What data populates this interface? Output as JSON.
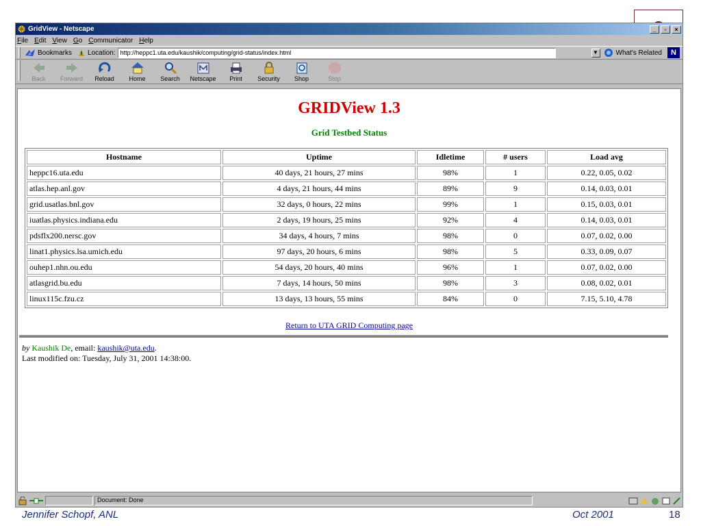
{
  "window": {
    "title": "GridView - Netscape"
  },
  "menu": [
    "File",
    "Edit",
    "View",
    "Go",
    "Communicator",
    "Help"
  ],
  "location_bar": {
    "bookmarks_label": "Bookmarks",
    "location_label": "Location:",
    "url": "http://heppc1.uta.edu/kaushik/computing/grid-status/index.html",
    "related_label": "What's Related"
  },
  "nav": [
    {
      "label": "Back",
      "icon": "back-arrow-icon",
      "disabled": true
    },
    {
      "label": "Forward",
      "icon": "forward-arrow-icon",
      "disabled": true
    },
    {
      "label": "Reload",
      "icon": "reload-icon",
      "disabled": false
    },
    {
      "label": "Home",
      "icon": "home-icon",
      "disabled": false
    },
    {
      "label": "Search",
      "icon": "search-icon",
      "disabled": false
    },
    {
      "label": "Netscape",
      "icon": "netscape-icon",
      "disabled": false
    },
    {
      "label": "Print",
      "icon": "print-icon",
      "disabled": false
    },
    {
      "label": "Security",
      "icon": "lock-icon",
      "disabled": false
    },
    {
      "label": "Shop",
      "icon": "shop-icon",
      "disabled": false
    },
    {
      "label": "Stop",
      "icon": "stop-icon",
      "disabled": true
    }
  ],
  "page": {
    "title": "GRIDView 1.3",
    "subtitle": "Grid Testbed Status",
    "table": {
      "headers": [
        "Hostname",
        "Uptime",
        "Idletime",
        "# users",
        "Load avg"
      ],
      "rows": [
        [
          "heppc16.uta.edu",
          "40 days, 21 hours, 27 mins",
          "98%",
          "1",
          "0.22, 0.05, 0.02"
        ],
        [
          "atlas.hep.anl.gov",
          "4 days, 21 hours, 44 mins",
          "89%",
          "9",
          "0.14, 0.03, 0.01"
        ],
        [
          "grid.usatlas.bnl.gov",
          "32 days, 0 hours, 22 mins",
          "99%",
          "1",
          "0.15, 0.03, 0.01"
        ],
        [
          "iuatlas.physics.indiana.edu",
          "2 days, 19 hours, 25 mins",
          "92%",
          "4",
          "0.14, 0.03, 0.01"
        ],
        [
          "pdsflx200.nersc.gov",
          "34 days, 4 hours, 7 mins",
          "98%",
          "0",
          "0.07, 0.02, 0.00"
        ],
        [
          "linat1.physics.lsa.umich.edu",
          "97 days, 20 hours, 6 mins",
          "98%",
          "5",
          "0.33, 0.09, 0.07"
        ],
        [
          "ouhep1.nhn.ou.edu",
          "54 days, 20 hours, 40 mins",
          "96%",
          "1",
          "0.07, 0.02, 0.00"
        ],
        [
          "atlasgrid.bu.edu",
          "7 days, 14 hours, 50 mins",
          "98%",
          "3",
          "0.08, 0.02, 0.01"
        ],
        [
          "linux115c.fzu.cz",
          "13 days, 13 hours, 55 mins",
          "84%",
          "0",
          "7.15, 5.10, 4.78"
        ]
      ]
    },
    "return_link": "Return to UTA GRID Computing page",
    "footer": {
      "by": "by",
      "author": "Kaushik De",
      "email_label": ", email:",
      "email": "kaushik@uta.edu",
      "email_end": ".",
      "modified": "Last modified on: Tuesday, July 31, 2001 14:38:00."
    }
  },
  "statusbar": {
    "text": "Document: Done"
  },
  "slide": {
    "presenter": "Jennifer Schopf, ANL",
    "date": "Oct 2001",
    "page": "18"
  }
}
